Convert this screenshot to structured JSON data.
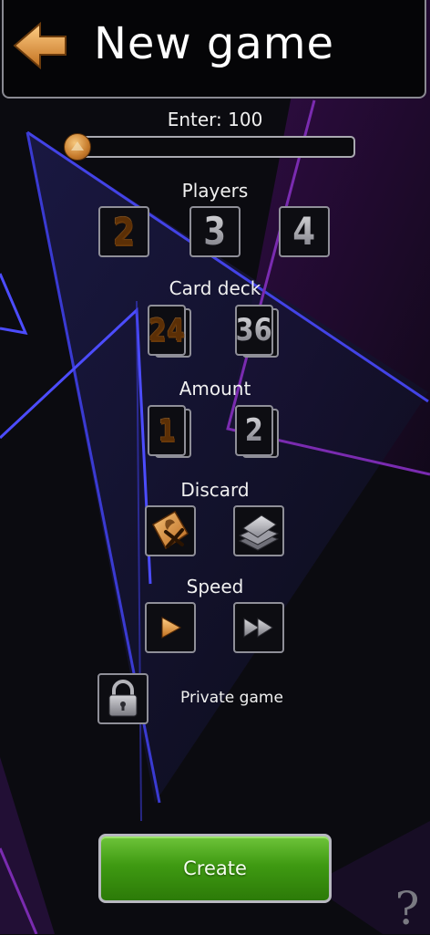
{
  "header": {
    "title": "New game",
    "back_icon": "arrow-left-icon"
  },
  "entry": {
    "label": "Enter: 100",
    "value": 100,
    "position_fraction": 0.0
  },
  "players": {
    "label": "Players",
    "options": [
      "2",
      "3",
      "4"
    ],
    "selected": "2"
  },
  "deck": {
    "label": "Card deck",
    "options": [
      "24",
      "36"
    ],
    "selected": "24"
  },
  "amount": {
    "label": "Amount",
    "options": [
      "1",
      "2"
    ],
    "selected": "1"
  },
  "discard": {
    "label": "Discard",
    "options": [
      "discard-cross-icon",
      "card-pile-icon"
    ],
    "selected": "discard-cross-icon"
  },
  "speed": {
    "label": "Speed",
    "options": [
      "play-icon",
      "fast-forward-icon"
    ],
    "selected": "play-icon"
  },
  "private": {
    "label": "Private game",
    "icon": "lock-icon"
  },
  "create": {
    "label": "Create"
  },
  "help": {
    "label": "?"
  },
  "colors": {
    "gold": "#e9a04c",
    "gray": "#9a9aa2",
    "green": "#3f9a12",
    "background": "#0b0b10",
    "accent_purple": "#5a1a78",
    "accent_blue": "#3a3aff"
  }
}
